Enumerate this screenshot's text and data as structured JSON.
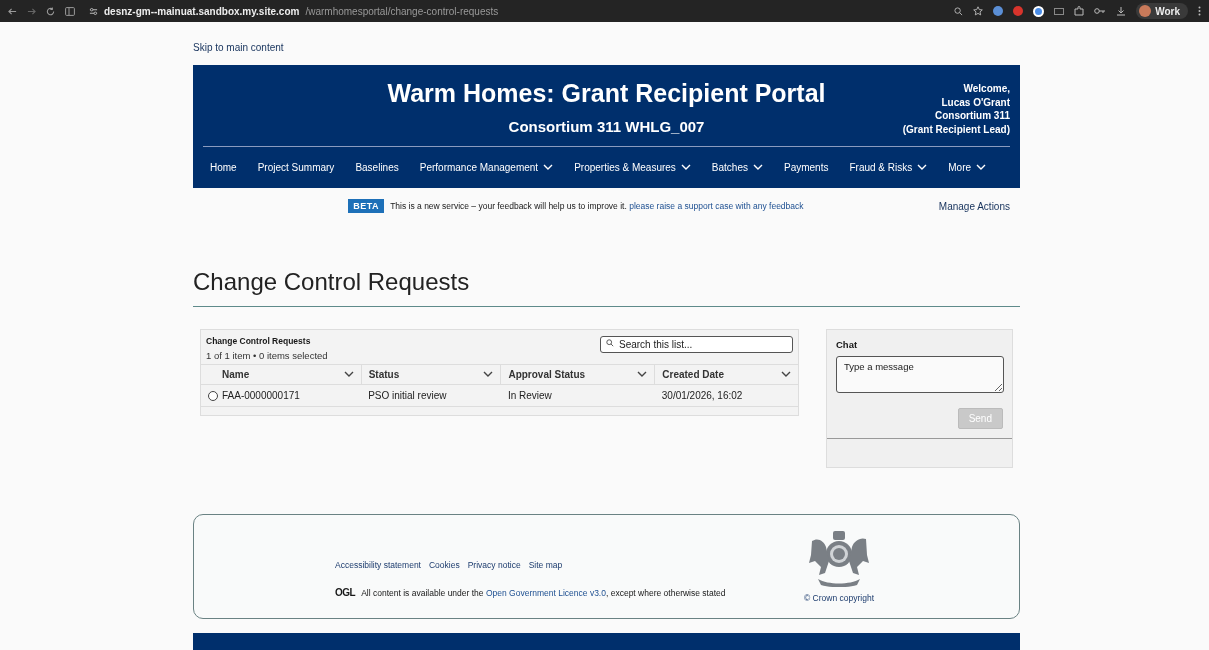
{
  "browser": {
    "host": "desnz-gm--mainuat.sandbox.my.site.com",
    "path": "/warmhomesportal/change-control-requests",
    "profile": "Work"
  },
  "skip_link": "Skip to main content",
  "header": {
    "title": "Warm Homes: Grant Recipient Portal",
    "subtitle": "Consortium 311 WHLG_007",
    "welcome": [
      "Welcome,",
      "Lucas O'Grant",
      "Consortium 311",
      "(Grant Recipient Lead)"
    ]
  },
  "nav": [
    {
      "label": "Home",
      "dropdown": false
    },
    {
      "label": "Project Summary",
      "dropdown": false
    },
    {
      "label": "Baselines",
      "dropdown": false
    },
    {
      "label": "Performance Management",
      "dropdown": true
    },
    {
      "label": "Properties & Measures",
      "dropdown": true
    },
    {
      "label": "Batches",
      "dropdown": true
    },
    {
      "label": "Payments",
      "dropdown": false
    },
    {
      "label": "Fraud & Risks",
      "dropdown": true
    },
    {
      "label": "More",
      "dropdown": true
    }
  ],
  "beta": {
    "tag": "BETA",
    "text": "This is a new service – your feedback will help us to improve it.",
    "link": "please raise a support case with any feedback"
  },
  "manage_actions": "Manage Actions",
  "page_title": "Change Control Requests",
  "list": {
    "title": "Change Control Requests",
    "summary": "1 of 1 item • 0 items selected",
    "search": {
      "placeholder": "Search this list..."
    },
    "columns": [
      "Name",
      "Status",
      "Approval Status",
      "Created Date"
    ],
    "rows": [
      {
        "selected": false,
        "cells": [
          "FAA-0000000171",
          "PSO initial review",
          "In Review",
          "30/01/2026, 16:02"
        ]
      }
    ]
  },
  "chat": {
    "title": "Chat",
    "input": {
      "placeholder": "Type a message"
    },
    "send": {
      "label": "Send",
      "disabled": true
    }
  },
  "footer": {
    "links": [
      "Accessibility statement",
      "Cookies",
      "Privacy notice",
      "Site map"
    ],
    "ogl": "OGL",
    "licence_prefix": "All content is available under the",
    "licence_link": "Open Government Licence v3.0",
    "licence_suffix": ", except where otherwise stated",
    "copyright": "© Crown copyright"
  }
}
